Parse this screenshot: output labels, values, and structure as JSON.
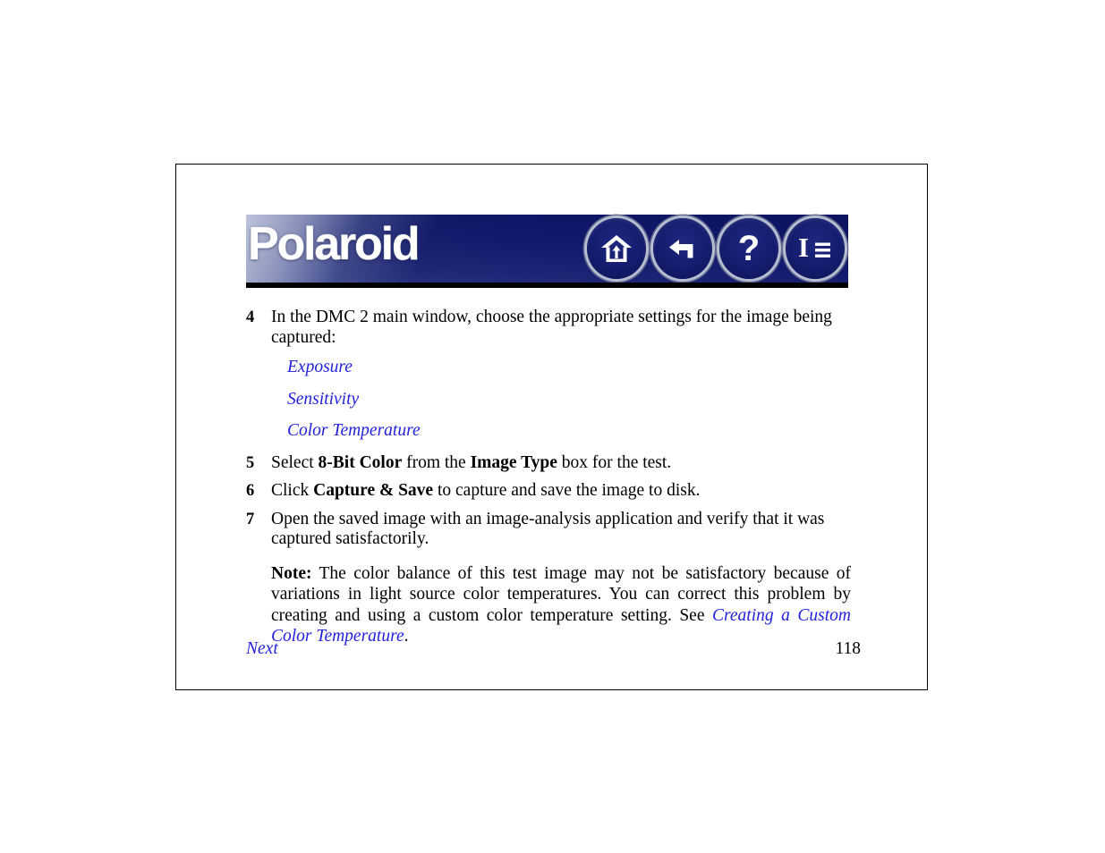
{
  "banner": {
    "logo": "Polaroid",
    "buttons": [
      {
        "name": "home",
        "icon": "home-icon",
        "label": "Home"
      },
      {
        "name": "back",
        "icon": "back-arrow-icon",
        "label": "Back"
      },
      {
        "name": "help",
        "icon": "question-mark-icon",
        "label": "Help",
        "glyph": "?"
      },
      {
        "name": "index",
        "icon": "index-icon",
        "label": "Index",
        "glyph": "I"
      }
    ],
    "colors": {
      "navy": "#111a6c",
      "rim": "#bec4d6",
      "bar": "#000000"
    }
  },
  "content": {
    "steps": [
      {
        "number": "4",
        "text": "In the DMC 2 main window, choose the appropriate settings for the image being captured:"
      },
      {
        "number": "5",
        "pre": "Select ",
        "bold1": "8-Bit Color",
        "mid": " from the ",
        "bold2": "Image Type",
        "post": " box for the test."
      },
      {
        "number": "6",
        "pre": "Click ",
        "bold1": "Capture & Save",
        "post": " to capture and save the image to disk."
      },
      {
        "number": "7",
        "text": "Open the saved image with an image-analysis application and verify that it was captured satisfactorily."
      }
    ],
    "sublinks": [
      "Exposure",
      "Sensitivity",
      "Color Temperature"
    ],
    "note": {
      "label": "Note:",
      "text": " The color balance of this test image may not be satisfactory because of variations in light source color temperatures. You can correct this problem by creating and using a custom color temperature setting. See ",
      "link": "Creating a Custom Color Temperature",
      "period": "."
    },
    "link_color": "#2222dd"
  },
  "footer": {
    "next_label": "Next",
    "page_number": "118"
  }
}
